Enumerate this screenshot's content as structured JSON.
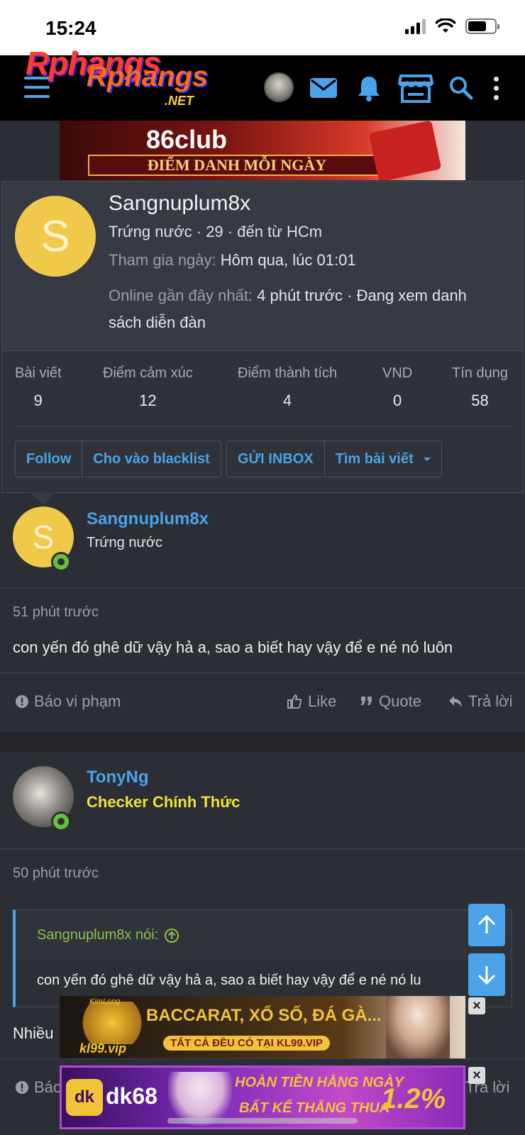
{
  "status_bar": {
    "time": "15:24"
  },
  "header": {
    "logo_line1": "Rphangs",
    "logo_line2": "Rphangs",
    "logo_suffix": ".NET",
    "colors": {
      "accent": "#4aa3e8",
      "header_bg": "#000000"
    }
  },
  "banner_top": {
    "title": "86club",
    "subtitle": "ĐIỂM DANH MỖI NGÀY"
  },
  "profile_card": {
    "avatar_letter": "S",
    "name": "Sangnuplum8x",
    "meta": "Trứng nước · 29 · đến từ HCm",
    "joined_label": "Tham gia ngày:",
    "joined_value": "Hôm qua, lúc 01:01",
    "online_label": "Online gần đây nhất:",
    "online_value_line1": "4 phút trước · Đang xem danh",
    "online_value_line2": "sách diễn đàn",
    "stats": [
      {
        "label": "Bài viết",
        "value": "9"
      },
      {
        "label": "Điểm cảm xúc",
        "value": "12"
      },
      {
        "label": "Điểm thành tích",
        "value": "4"
      },
      {
        "label": "VND",
        "value": "0"
      },
      {
        "label": "Tín dụng",
        "value": "58"
      }
    ],
    "buttons": {
      "follow": "Follow",
      "blacklist": "Cho vào blacklist",
      "inbox": "GỬI INBOX",
      "find_posts": "Tìm bài viết"
    }
  },
  "post1": {
    "avatar_letter": "S",
    "username": "Sangnuplum8x",
    "user_title": "Trứng nước",
    "time": "51 phút trước",
    "content": "con yến đó ghê dữ vậy hả a, sao a biết hay vậy để e né nó luôn",
    "actions": {
      "report": "Báo vi phạm",
      "like": "Like",
      "quote": "Quote",
      "reply": "Trả lời"
    }
  },
  "post2": {
    "username": "TonyNg",
    "user_title": "Checker Chính Thức",
    "time": "50 phút trước",
    "quote_author": "Sangnuplum8x nói:",
    "quote_text": "con yến đó ghê dữ vậy hả a, sao a biết hay vậy để e né nó lu",
    "content_start": "Nhiều",
    "actions": {
      "report": "Báo",
      "reply": "Trả lời"
    }
  },
  "ad1": {
    "brand": "KimLong",
    "site": "kl99.vip",
    "headline": "BACCARAT, XỔ SỐ, ĐÁ GÀ...",
    "tagline": "TẤT CẢ ĐỀU CÓ TẠI KL99.VIP"
  },
  "ad2": {
    "logo": "dk",
    "brand": "dk68",
    "headline": "HOÀN TIỀN HẰNG NGÀY",
    "percent": "1.2%",
    "tagline": "BẤT KỂ THẮNG THUA"
  }
}
